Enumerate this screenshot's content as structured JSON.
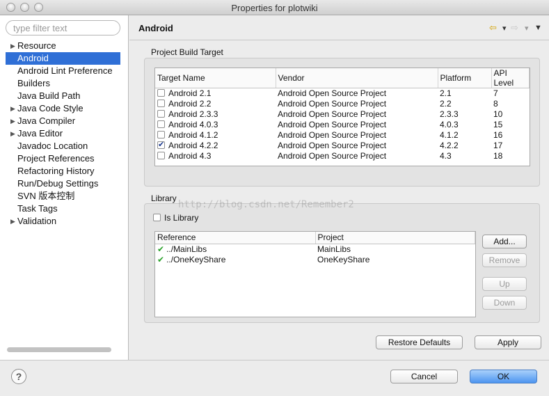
{
  "window": {
    "title": "Properties for plotwiki"
  },
  "sidebar": {
    "filter_placeholder": "type filter text",
    "items": [
      {
        "label": "Resource",
        "expandable": true
      },
      {
        "label": "Android",
        "selected": true
      },
      {
        "label": "Android Lint Preference"
      },
      {
        "label": "Builders"
      },
      {
        "label": "Java Build Path"
      },
      {
        "label": "Java Code Style",
        "expandable": true
      },
      {
        "label": "Java Compiler",
        "expandable": true
      },
      {
        "label": "Java Editor",
        "expandable": true
      },
      {
        "label": "Javadoc Location"
      },
      {
        "label": "Project References"
      },
      {
        "label": "Refactoring History"
      },
      {
        "label": "Run/Debug Settings"
      },
      {
        "label": "SVN 版本控制"
      },
      {
        "label": "Task Tags"
      },
      {
        "label": "Validation",
        "expandable": true
      }
    ]
  },
  "page": {
    "title": "Android",
    "build_target": {
      "label": "Project Build Target",
      "columns": [
        "Target Name",
        "Vendor",
        "Platform",
        "API Level"
      ],
      "rows": [
        {
          "name": "Android 2.1",
          "vendor": "Android Open Source Project",
          "platform": "2.1",
          "api": "7",
          "checked": false
        },
        {
          "name": "Android 2.2",
          "vendor": "Android Open Source Project",
          "platform": "2.2",
          "api": "8",
          "checked": false
        },
        {
          "name": "Android 2.3.3",
          "vendor": "Android Open Source Project",
          "platform": "2.3.3",
          "api": "10",
          "checked": false
        },
        {
          "name": "Android 4.0.3",
          "vendor": "Android Open Source Project",
          "platform": "4.0.3",
          "api": "15",
          "checked": false
        },
        {
          "name": "Android 4.1.2",
          "vendor": "Android Open Source Project",
          "platform": "4.1.2",
          "api": "16",
          "checked": false
        },
        {
          "name": "Android 4.2.2",
          "vendor": "Android Open Source Project",
          "platform": "4.2.2",
          "api": "17",
          "checked": true
        },
        {
          "name": "Android 4.3",
          "vendor": "Android Open Source Project",
          "platform": "4.3",
          "api": "18",
          "checked": false
        }
      ]
    },
    "library": {
      "label": "Library",
      "is_library_label": "Is Library",
      "is_library_checked": false,
      "columns": [
        "Reference",
        "Project"
      ],
      "rows": [
        {
          "reference": "../MainLibs",
          "project": "MainLibs"
        },
        {
          "reference": "../OneKeyShare",
          "project": "OneKeyShare"
        }
      ],
      "buttons": {
        "add": "Add...",
        "remove": "Remove",
        "up": "Up",
        "down": "Down"
      }
    },
    "restore_defaults": "Restore Defaults",
    "apply": "Apply"
  },
  "dialog": {
    "help": "?",
    "cancel": "Cancel",
    "ok": "OK"
  },
  "watermark": "http://blog.csdn.net/Remember2",
  "colors": {
    "selection": "#2f6fd6",
    "ok_button": "#4d95f0",
    "check_ok": "#2aa12a"
  }
}
